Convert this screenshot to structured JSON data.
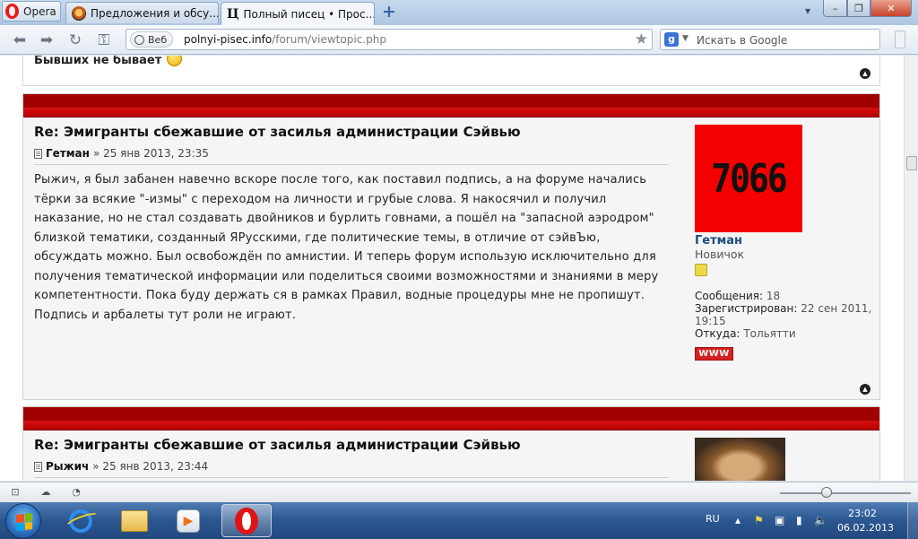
{
  "browser": {
    "menu_label": "Opera",
    "tabs": [
      {
        "label": "Предложения и обсу..."
      },
      {
        "label": "Полный писец • Прос...",
        "favicon_glyph": "Ц"
      }
    ],
    "new_tab_glyph": "+",
    "window_controls": {
      "tabs_menu": "▾",
      "minimize": "–",
      "maximize": "❐",
      "close": "✕"
    },
    "address": {
      "badge": "Веб",
      "host": "polnyi-pisec.info",
      "path": "/forum/viewtopic.php"
    },
    "search": {
      "engine_glyph": "g",
      "placeholder": "Искать в Google"
    },
    "nav_glyphs": {
      "back": "⬅",
      "forward": "➡",
      "reload": "↻",
      "key": "⚿",
      "star": "★"
    }
  },
  "page": {
    "previous_post": {
      "text": "Бывших не бывает"
    },
    "posts": [
      {
        "title": "Re: Эмигранты сбежавшие от засилья администрации Сэйвью",
        "author": "Гетман",
        "date": "» 25 янв 2013, 23:35",
        "body": "Рыжич, я был забанен навечно вскоре после того, как поставил подпись, а на форуме начались тёрки за всякие \"-измы\" с переходом на личности и грубые слова. Я накосячил и получил наказание, но не стал создавать двойников и бурлить говнами, а пошёл на \"запасной аэродром\" близкой тематики, созданный ЯРусскими, где политические темы, в отличие от сэйвЪю, обсуждать можно. Был освобождён по амнистии. И теперь форум использую исключительно для получения тематической информации или поделиться своими возможностями и знаниями в меру компетентности. Пока буду держать ся в рамках Правил, водные процедуры мне не пропишут. Подпись и арбалеты тут роли не играют.",
        "profile": {
          "avatar_text": "7066",
          "name": "Гетман",
          "rank": "Новичок",
          "posts_label": "Сообщения:",
          "posts_value": "18",
          "registered_label": "Зарегистрирован:",
          "registered_value": "22 сен 2011, 19:15",
          "from_label": "Откуда:",
          "from_value": "Тольятти",
          "www_label": "WWW"
        }
      },
      {
        "title": "Re: Эмигранты сбежавшие от засилья администрации Сэйвью",
        "author": "Рыжич",
        "date": "» 25 янв 2013, 23:44"
      }
    ],
    "top_glyph": "▲"
  },
  "statusbar": {
    "glyphs": [
      "⊡",
      "☁",
      "◔"
    ]
  },
  "taskbar": {
    "language": "RU",
    "clock_time": "23:02",
    "clock_date": "06.02.2013",
    "tray_glyphs": [
      "▴",
      "⚑",
      "▣",
      "▮",
      "🔈"
    ]
  },
  "colors": {
    "post_bar_red": "#a00000",
    "avatar_red": "#f40000",
    "profile_name": "#1c4e7e",
    "taskbar_blue": "#2b5690"
  }
}
